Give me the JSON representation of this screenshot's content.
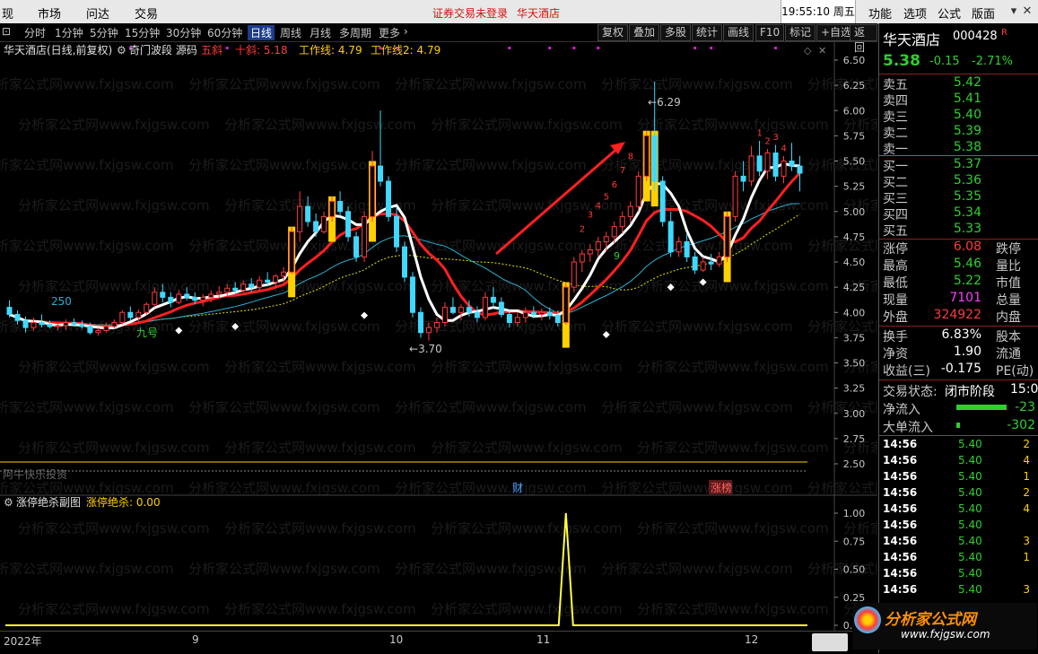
{
  "topbar": {
    "menus": [
      "现",
      "市场",
      "问达",
      "交易"
    ],
    "notice": "证券交易未登录",
    "notice_stock": "华天酒店",
    "clock": "19:55:10 周五",
    "right_menus": [
      "功能",
      "选项",
      "公式",
      "版面"
    ]
  },
  "periods": [
    "分时",
    "1分钟",
    "5分钟",
    "15分钟",
    "30分钟",
    "60分钟",
    "日线",
    "周线",
    "月线",
    "多周期",
    "更多"
  ],
  "active_period": "日线",
  "toolbar_buttons": [
    "复权",
    "叠加",
    "多股",
    "统计",
    "画线",
    "F10",
    "标记",
    "+自选",
    "返回"
  ],
  "main_header": {
    "title": "华天酒店(日线,前复权)",
    "indicator_name": "奇门波段 源码",
    "wuxie": "五斜",
    "shixie": "十斜: 5.18",
    "workline": "工作线: 4.79",
    "workline2": "工作线2: 4.79"
  },
  "sub_header": {
    "name": "涨停绝杀副图",
    "value_label": "涨停绝杀: 0.00"
  },
  "chart_text": {
    "ma_label": "250",
    "low_label": "3.70",
    "high_label": "6.29",
    "jiuzhuan": "九号",
    "seq_numbers_up": [
      "2",
      "3",
      "4",
      "5",
      "6",
      "7",
      "8"
    ],
    "seq_nine": "9",
    "right_seq": [
      "1",
      "2",
      "3",
      "4"
    ],
    "watermark_brand": "阿牛快乐投资",
    "flag_cai": "财",
    "flag_zhangbang": "涨榜"
  },
  "axis": {
    "main_ticks": [
      "6.50",
      "6.25",
      "6.00",
      "5.75",
      "5.50",
      "5.25",
      "5.00",
      "4.75",
      "4.50",
      "4.25",
      "4.00",
      "3.75",
      "3.50",
      "3.25",
      "3.00",
      "2.75",
      "2.50"
    ],
    "sub_ticks": [
      "1.00",
      "0.75",
      "0.50",
      "0.25",
      "0.00"
    ],
    "date_labels": [
      "2022年",
      "9",
      "10",
      "11",
      "12"
    ]
  },
  "colors": {
    "up": "#ff3b3b",
    "down": "#40d8ff",
    "ma_white": "#ffffff",
    "ma_red": "#ff2020",
    "ma_yellow_dotted": "#e6e600",
    "ma_cyan": "#2ab0d0",
    "signal_bar": "#ffd000",
    "sub_line": "#ffff40",
    "arrow": "#ff2020",
    "purple_dots": "#d020d0"
  },
  "quote": {
    "name": "华天酒店",
    "code": "000428",
    "r_badge": "R",
    "price": "5.38",
    "change": "-0.15",
    "change_pct": "-2.71%",
    "asks": [
      {
        "label": "卖五",
        "price": "5.42"
      },
      {
        "label": "卖四",
        "price": "5.41"
      },
      {
        "label": "卖三",
        "price": "5.40"
      },
      {
        "label": "卖二",
        "price": "5.39"
      },
      {
        "label": "卖一",
        "price": "5.38"
      }
    ],
    "bids": [
      {
        "label": "买一",
        "price": "5.37"
      },
      {
        "label": "买二",
        "price": "5.36"
      },
      {
        "label": "买三",
        "price": "5.35"
      },
      {
        "label": "买四",
        "price": "5.34"
      },
      {
        "label": "买五",
        "price": "5.33"
      }
    ],
    "stats": [
      {
        "l1": "涨停",
        "v1": "6.08",
        "c1": "red",
        "l2": "跌停"
      },
      {
        "l1": "最高",
        "v1": "5.46",
        "c1": "green",
        "l2": "量比"
      },
      {
        "l1": "最低",
        "v1": "5.22",
        "c1": "green",
        "l2": "市值"
      },
      {
        "l1": "现量",
        "v1": "7101",
        "c1": "magenta",
        "l2": "总量"
      },
      {
        "l1": "外盘",
        "v1": "324922",
        "c1": "red",
        "l2": "内盘"
      }
    ],
    "stats2": [
      {
        "l1": "换手",
        "v1": "6.83%",
        "l2": "股本"
      },
      {
        "l1": "净资",
        "v1": "1.90",
        "l2": "流通"
      },
      {
        "l1": "收益(三)",
        "v1": "-0.175",
        "l2": "PE(动)"
      }
    ],
    "trade_state_label": "交易状态:",
    "trade_state": "闭市阶段",
    "trade_state_time": "15:0",
    "net_inflow_label": "净流入",
    "net_inflow": "-23",
    "big_inflow_label": "大单流入",
    "big_inflow": "-302",
    "ticks": [
      {
        "t": "14:56",
        "p": "5.40",
        "v": "2"
      },
      {
        "t": "14:56",
        "p": "5.40",
        "v": "4"
      },
      {
        "t": "14:56",
        "p": "5.40",
        "v": "1"
      },
      {
        "t": "14:56",
        "p": "5.40",
        "v": "2"
      },
      {
        "t": "14:56",
        "p": "5.40",
        "v": "4"
      },
      {
        "t": "14:56",
        "p": "5.40",
        "v": ""
      },
      {
        "t": "14:56",
        "p": "5.40",
        "v": "3"
      },
      {
        "t": "14:56",
        "p": "5.40",
        "v": "1"
      },
      {
        "t": "14:56",
        "p": "5.40",
        "v": ""
      },
      {
        "t": "14:56",
        "p": "5.40",
        "v": "3"
      }
    ]
  },
  "watermark": {
    "logo_text": "分析家公式网",
    "logo_url": "www.fxjgsw.com"
  },
  "chart_data": {
    "type": "candlestick",
    "title": "华天酒店(日线,前复权)",
    "price_axis": {
      "ylim": [
        2.5,
        6.5
      ]
    },
    "candles": [
      [
        4.05,
        4.12,
        3.95,
        3.98
      ],
      [
        3.98,
        4.02,
        3.88,
        3.92
      ],
      [
        3.92,
        3.96,
        3.8,
        3.85
      ],
      [
        3.85,
        3.95,
        3.82,
        3.9
      ],
      [
        3.9,
        3.98,
        3.85,
        3.88
      ],
      [
        3.88,
        3.92,
        3.84,
        3.86
      ],
      [
        3.86,
        3.9,
        3.82,
        3.87
      ],
      [
        3.87,
        3.93,
        3.83,
        3.9
      ],
      [
        3.9,
        3.94,
        3.86,
        3.88
      ],
      [
        3.88,
        3.92,
        3.84,
        3.86
      ],
      [
        3.86,
        3.9,
        3.78,
        3.8
      ],
      [
        3.8,
        3.85,
        3.77,
        3.82
      ],
      [
        3.82,
        3.9,
        3.8,
        3.86
      ],
      [
        3.86,
        3.93,
        3.84,
        3.9
      ],
      [
        3.9,
        4.02,
        3.88,
        4.0
      ],
      [
        4.0,
        4.06,
        3.92,
        3.95
      ],
      [
        3.95,
        4.03,
        3.9,
        4.0
      ],
      [
        4.0,
        4.1,
        3.97,
        4.08
      ],
      [
        4.08,
        4.25,
        4.05,
        4.2
      ],
      [
        4.2,
        4.28,
        4.1,
        4.15
      ],
      [
        4.15,
        4.2,
        4.05,
        4.1
      ],
      [
        4.1,
        4.22,
        4.08,
        4.18
      ],
      [
        4.18,
        4.25,
        4.12,
        4.15
      ],
      [
        4.15,
        4.2,
        4.08,
        4.12
      ],
      [
        4.12,
        4.18,
        4.06,
        4.15
      ],
      [
        4.15,
        4.22,
        4.1,
        4.18
      ],
      [
        4.18,
        4.26,
        4.14,
        4.2
      ],
      [
        4.2,
        4.28,
        4.16,
        4.24
      ],
      [
        4.24,
        4.3,
        4.18,
        4.22
      ],
      [
        4.22,
        4.32,
        4.2,
        4.28
      ],
      [
        4.28,
        4.34,
        4.2,
        4.25
      ],
      [
        4.25,
        4.36,
        4.22,
        4.32
      ],
      [
        4.32,
        4.4,
        4.26,
        4.3
      ],
      [
        4.3,
        4.38,
        4.24,
        4.36
      ],
      [
        4.36,
        4.45,
        4.3,
        4.4
      ],
      [
        4.4,
        4.85,
        4.38,
        4.8
      ],
      [
        4.8,
        5.2,
        4.7,
        5.05
      ],
      [
        5.05,
        5.15,
        4.85,
        4.9
      ],
      [
        4.9,
        4.98,
        4.75,
        4.8
      ],
      [
        4.8,
        5.0,
        4.78,
        4.95
      ],
      [
        4.95,
        5.15,
        4.9,
        5.1
      ],
      [
        5.1,
        5.2,
        4.95,
        5.0
      ],
      [
        5.0,
        5.05,
        4.7,
        4.75
      ],
      [
        4.75,
        4.8,
        4.5,
        4.55
      ],
      [
        4.55,
        5.0,
        4.5,
        4.95
      ],
      [
        4.95,
        5.6,
        4.9,
        5.45
      ],
      [
        5.45,
        6.0,
        5.25,
        5.3
      ],
      [
        5.3,
        5.35,
        4.9,
        4.95
      ],
      [
        4.95,
        5.05,
        4.6,
        4.65
      ],
      [
        4.65,
        4.7,
        4.3,
        4.35
      ],
      [
        4.35,
        4.4,
        3.95,
        4.0
      ],
      [
        4.0,
        4.05,
        3.75,
        3.8
      ],
      [
        3.8,
        3.9,
        3.72,
        3.85
      ],
      [
        3.85,
        3.95,
        3.8,
        3.9
      ],
      [
        3.9,
        4.1,
        3.86,
        4.05
      ],
      [
        4.05,
        4.15,
        3.98,
        4.0
      ],
      [
        4.0,
        4.08,
        3.92,
        4.05
      ],
      [
        4.05,
        4.12,
        3.96,
        4.0
      ],
      [
        4.0,
        4.06,
        3.9,
        3.95
      ],
      [
        3.95,
        4.2,
        3.92,
        4.15
      ],
      [
        4.15,
        4.25,
        4.05,
        4.1
      ],
      [
        4.1,
        4.15,
        3.95,
        3.98
      ],
      [
        3.98,
        4.02,
        3.85,
        3.9
      ],
      [
        3.9,
        4.0,
        3.86,
        3.95
      ],
      [
        3.95,
        4.05,
        3.9,
        4.0
      ],
      [
        4.0,
        4.06,
        3.94,
        3.98
      ],
      [
        3.98,
        4.04,
        3.92,
        4.0
      ],
      [
        4.0,
        4.05,
        3.93,
        3.97
      ],
      [
        3.97,
        4.02,
        3.86,
        3.9
      ],
      [
        3.9,
        4.3,
        3.88,
        4.25
      ],
      [
        4.25,
        4.55,
        4.2,
        4.5
      ],
      [
        4.5,
        4.62,
        4.4,
        4.58
      ],
      [
        4.58,
        4.68,
        4.5,
        4.62
      ],
      [
        4.62,
        4.75,
        4.55,
        4.7
      ],
      [
        4.7,
        4.8,
        4.6,
        4.75
      ],
      [
        4.75,
        4.9,
        4.68,
        4.85
      ],
      [
        4.85,
        5.0,
        4.78,
        4.95
      ],
      [
        4.95,
        5.1,
        4.88,
        5.05
      ],
      [
        5.05,
        5.4,
        5.0,
        5.35
      ],
      [
        5.35,
        5.8,
        5.3,
        5.75
      ],
      [
        5.75,
        6.29,
        5.2,
        5.3
      ],
      [
        5.3,
        5.35,
        4.85,
        4.9
      ],
      [
        4.9,
        5.0,
        4.55,
        4.6
      ],
      [
        4.6,
        4.75,
        4.55,
        4.7
      ],
      [
        4.7,
        4.78,
        4.5,
        4.55
      ],
      [
        4.55,
        4.6,
        4.38,
        4.42
      ],
      [
        4.42,
        4.55,
        4.4,
        4.5
      ],
      [
        4.5,
        4.58,
        4.42,
        4.48
      ],
      [
        4.48,
        4.6,
        4.45,
        4.55
      ],
      [
        4.55,
        5.0,
        4.5,
        4.95
      ],
      [
        4.95,
        5.4,
        4.9,
        5.35
      ],
      [
        5.35,
        5.5,
        5.2,
        5.3
      ],
      [
        5.3,
        5.65,
        5.25,
        5.55
      ],
      [
        5.55,
        5.7,
        5.35,
        5.4
      ],
      [
        5.4,
        5.62,
        5.32,
        5.58
      ],
      [
        5.58,
        5.66,
        5.3,
        5.35
      ],
      [
        5.35,
        5.55,
        5.28,
        5.5
      ],
      [
        5.5,
        5.68,
        5.4,
        5.45
      ],
      [
        5.45,
        5.55,
        5.2,
        5.38
      ]
    ],
    "signals": {
      "yellow_bar_indices": [
        35,
        40,
        45,
        69,
        79,
        80,
        89
      ],
      "white_diamonds": [
        [
          21,
          3.82
        ],
        [
          28,
          3.86
        ],
        [
          44,
          3.97
        ],
        [
          74,
          3.78
        ],
        [
          82,
          4.25
        ],
        [
          86,
          4.3
        ]
      ],
      "purple_dots_row": [
        [
          15,
          6.62
        ],
        [
          27,
          6.62
        ],
        [
          46,
          6.62
        ],
        [
          48,
          6.62
        ],
        [
          62,
          6.62
        ],
        [
          67,
          6.62
        ],
        [
          70,
          6.62
        ],
        [
          73,
          6.62
        ],
        [
          85,
          6.62
        ],
        [
          87,
          6.62
        ],
        [
          95,
          6.62
        ]
      ]
    },
    "sub_series": {
      "name": "涨停绝杀",
      "spike_index": 69,
      "ylim": [
        0,
        1
      ]
    }
  }
}
